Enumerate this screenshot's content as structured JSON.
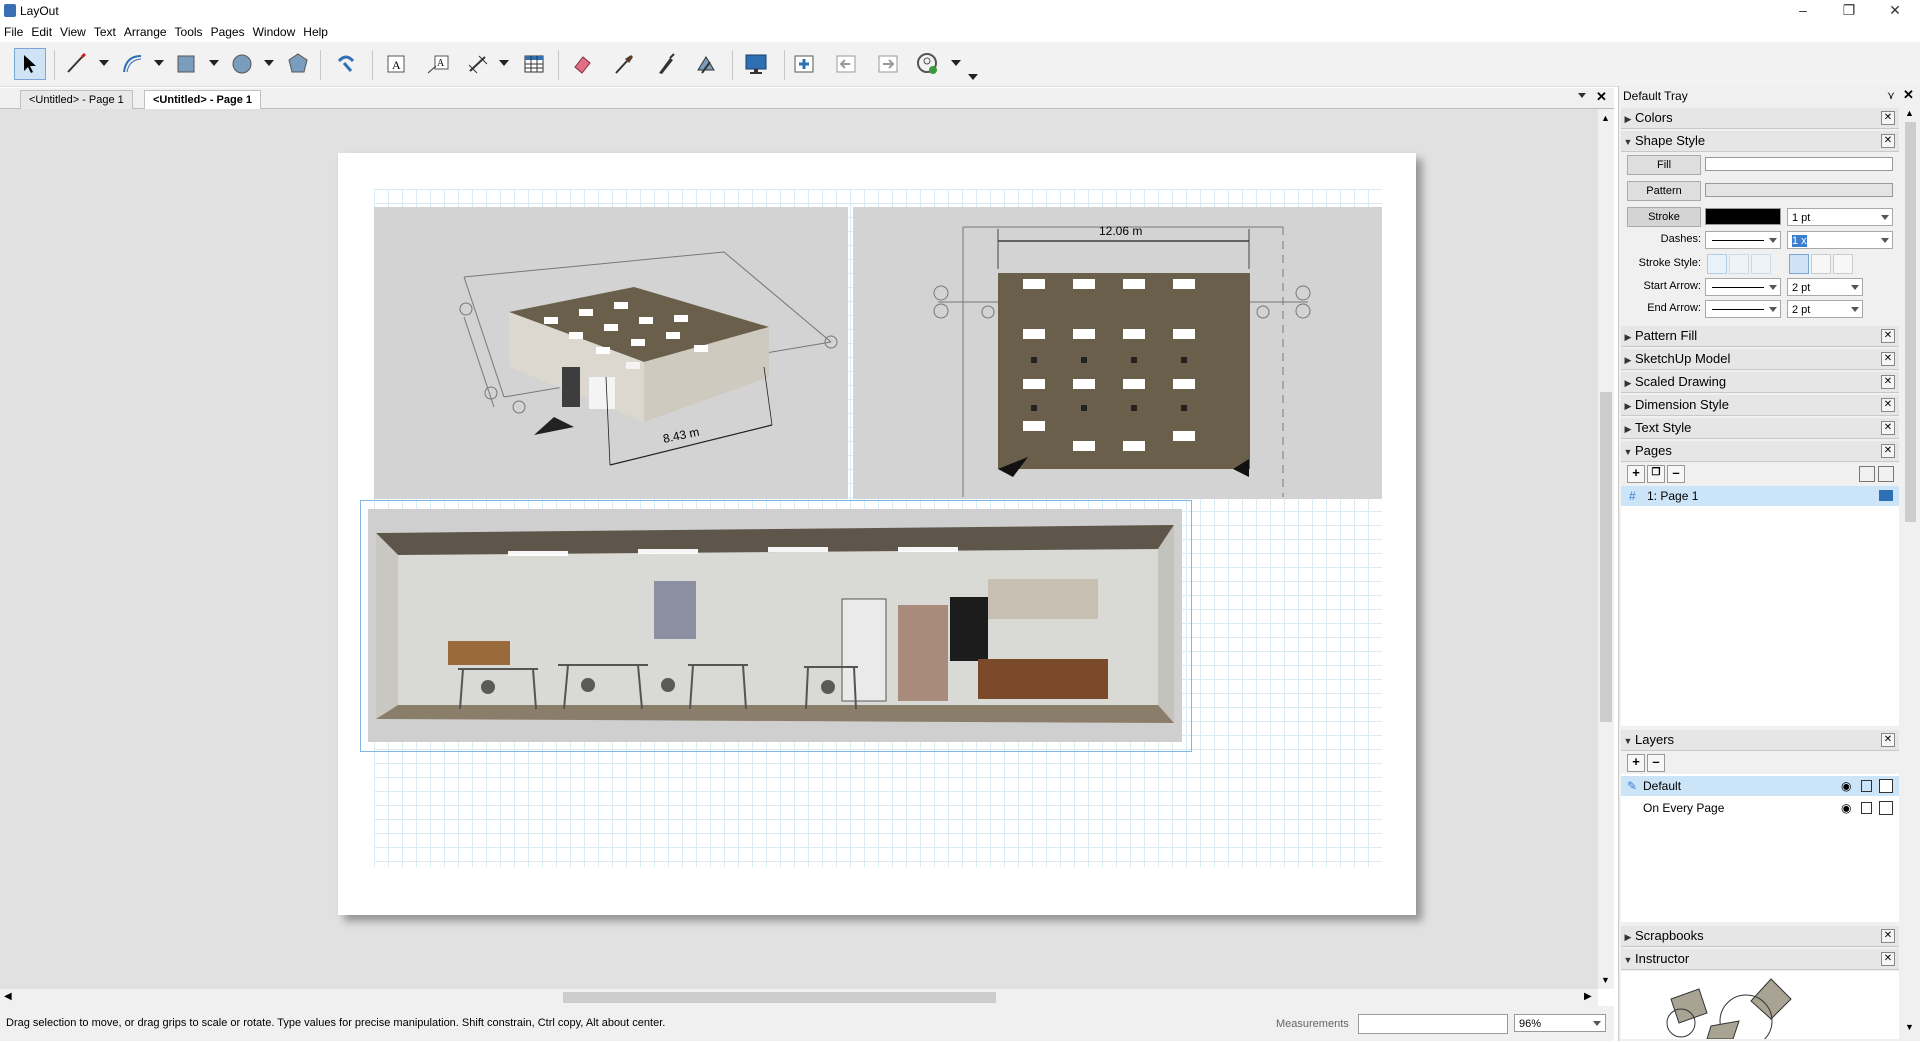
{
  "window": {
    "title": "LayOut"
  },
  "menu": [
    "File",
    "Edit",
    "View",
    "Text",
    "Arrange",
    "Tools",
    "Pages",
    "Window",
    "Help"
  ],
  "tabs": [
    "<Untitled> - Page 1",
    "<Untitled> - Page 1"
  ],
  "drawing": {
    "dim_top_left": "8.43 m",
    "dim_top_right": "12.06 m"
  },
  "status": {
    "hint": "Drag selection to move, or drag grips to scale or rotate. Type values for precise manipulation. Shift constrain, Ctrl copy, Alt about center.",
    "measurements_label": "Measurements",
    "zoom": "96%"
  },
  "tray": {
    "title": "Default Tray",
    "panels": {
      "colors": "Colors",
      "shape_style": "Shape Style",
      "pattern_fill": "Pattern Fill",
      "sketchup_model": "SketchUp Model",
      "scaled_drawing": "Scaled Drawing",
      "dimension_style": "Dimension Style",
      "text_style": "Text Style",
      "pages": "Pages",
      "layers": "Layers",
      "scrapbooks": "Scrapbooks",
      "instructor": "Instructor"
    },
    "shape_style": {
      "fill": "Fill",
      "pattern": "Pattern",
      "stroke": "Stroke",
      "stroke_width": "1 pt",
      "dashes_label": "Dashes:",
      "dash_scale": "1 x",
      "stroke_style_label": "Stroke Style:",
      "start_arrow_label": "Start Arrow:",
      "start_arrow_size": "2 pt",
      "end_arrow_label": "End Arrow:",
      "end_arrow_size": "2 pt"
    },
    "pages": {
      "hash": "#",
      "items": [
        "1:  Page 1"
      ]
    },
    "layers": {
      "items": [
        "Default",
        "On Every Page"
      ]
    },
    "colors_hex": {
      "selection": "#cce4f7",
      "stroke": "#000000"
    }
  }
}
